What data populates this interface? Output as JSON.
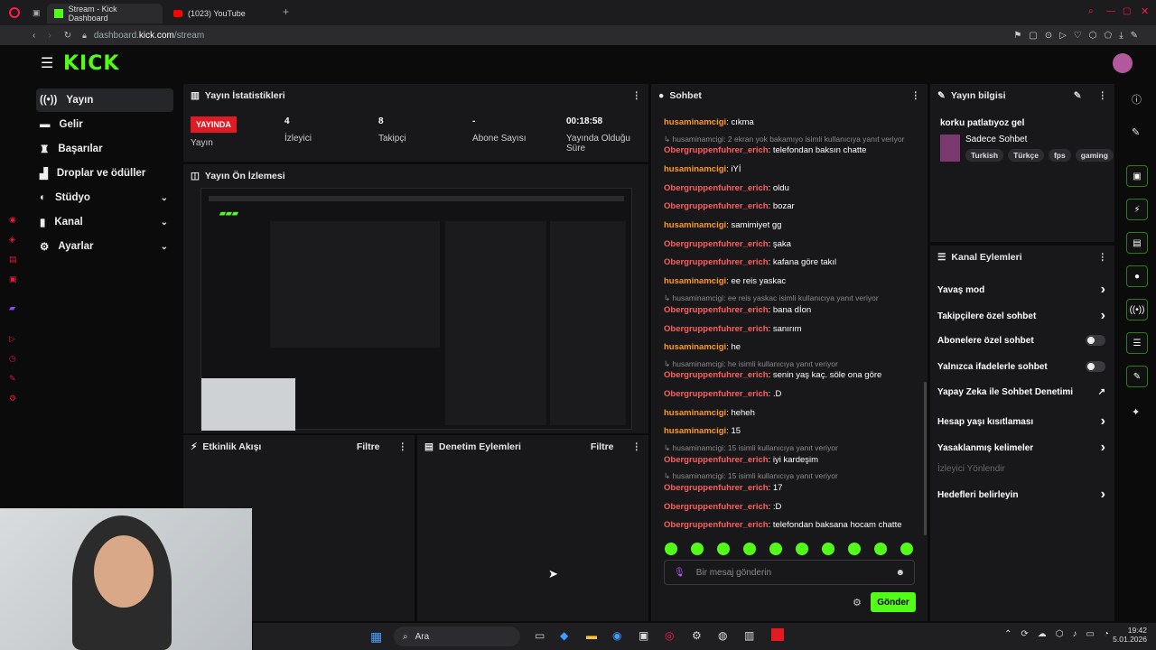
{
  "browser": {
    "tabs": [
      {
        "label": "Stream - Kick Dashboard"
      },
      {
        "label": "(1023) YouTube"
      }
    ],
    "url_prefix": "dashboard.",
    "url_domain": "kick.com",
    "url_path": "/stream"
  },
  "logo": "KICK",
  "sidebar": {
    "items": [
      {
        "label": "Yayın"
      },
      {
        "label": "Gelir"
      },
      {
        "label": "Başarılar"
      },
      {
        "label": "Droplar ve ödüller"
      },
      {
        "label": "Stüdyo"
      },
      {
        "label": "Kanal"
      },
      {
        "label": "Ayarlar"
      }
    ]
  },
  "stats": {
    "title": "Yayın İstatistikleri",
    "live_badge": "YAYINDA",
    "live_label": "Yayın",
    "viewers_value": "4",
    "viewers_label": "İzleyici",
    "followers_value": "8",
    "followers_label": "Takipçi",
    "subs_value": "-",
    "subs_label": "Abone Sayısı",
    "duration_value": "00:18:58",
    "duration_label": "Yayında Olduğu Süre"
  },
  "preview": {
    "title": "Yayın Ön İzlemesi"
  },
  "activity": {
    "title": "Etkinlik Akışı",
    "filter": "Filtre"
  },
  "moderation": {
    "title": "Denetim Eylemleri",
    "filter": "Filtre"
  },
  "chat": {
    "title": "Sohbet",
    "messages": [
      {
        "user": "husaminamcigi",
        "utype": "u1",
        "text": ": cıkma"
      },
      {
        "reply": "husaminamcigi: 2 ekran yok bakamıyo isimli kullanıcıya yanıt veriyor"
      },
      {
        "user": "Obergruppenfuhrer_erich",
        "utype": "u2",
        "text": ": telefondan baksın chatte"
      },
      {
        "user": "husaminamcigi",
        "utype": "u1",
        "text": ": iYİ"
      },
      {
        "user": "Obergruppenfuhrer_erich",
        "utype": "u2",
        "text": ": oldu"
      },
      {
        "user": "Obergruppenfuhrer_erich",
        "utype": "u2",
        "text": ": bozar"
      },
      {
        "user": "husaminamcigi",
        "utype": "u1",
        "text": ": samimiyet gg"
      },
      {
        "user": "Obergruppenfuhrer_erich",
        "utype": "u2",
        "text": ": şaka"
      },
      {
        "user": "Obergruppenfuhrer_erich",
        "utype": "u2",
        "text": ": kafana göre takıl"
      },
      {
        "user": "husaminamcigi",
        "utype": "u1",
        "text": ": ee reis yaskac"
      },
      {
        "reply": "husaminamcigi: ee reis yaskac isimli kullanıcıya yanıt veriyor"
      },
      {
        "user": "Obergruppenfuhrer_erich",
        "utype": "u2",
        "text": ": bana dİon"
      },
      {
        "user": "Obergruppenfuhrer_erich",
        "utype": "u2",
        "text": ": sanırım"
      },
      {
        "user": "husaminamcigi",
        "utype": "u1",
        "text": ": he"
      },
      {
        "reply": "husaminamcigi: he isimli kullanıcıya yanıt veriyor"
      },
      {
        "user": "Obergruppenfuhrer_erich",
        "utype": "u2",
        "text": ": senin yaş kaç. söle ona göre"
      },
      {
        "user": "Obergruppenfuhrer_erich",
        "utype": "u2",
        "text": ": .D"
      },
      {
        "user": "husaminamcigi",
        "utype": "u1",
        "text": ": heheh"
      },
      {
        "user": "husaminamcigi",
        "utype": "u1",
        "text": ": 15"
      },
      {
        "reply": "husaminamcigi: 15 isimli kullanıcıya yanıt veriyor"
      },
      {
        "user": "Obergruppenfuhrer_erich",
        "utype": "u2",
        "text": ": iyi kardeşim"
      },
      {
        "reply": "husaminamcigi: 15 isimli kullanıcıya yanıt veriyor"
      },
      {
        "user": "Obergruppenfuhrer_erich",
        "utype": "u2",
        "text": ": 17"
      },
      {
        "user": "Obergruppenfuhrer_erich",
        "utype": "u2",
        "text": ": :D"
      },
      {
        "user": "Obergruppenfuhrer_erich",
        "utype": "u2",
        "text": ": telefondan baksana hocam chatte"
      }
    ],
    "input_placeholder": "Bir mesaj gönderin",
    "send_label": "Gönder"
  },
  "stream_info": {
    "title": "Yayın bilgisi",
    "stream_title": "korku patlatıyoz gel",
    "category": "Sadece Sohbet",
    "tags": [
      "Turkish",
      "Türkçe",
      "fps",
      "gaming"
    ]
  },
  "channel_actions": {
    "title": "Kanal Eylemleri",
    "items": [
      {
        "label": "Yavaş mod",
        "control": "arrow"
      },
      {
        "label": "Takipçilere özel sohbet",
        "control": "arrow"
      },
      {
        "label": "Abonelere özel sohbet",
        "control": "toggle"
      },
      {
        "label": "Yalnızca ifadelerle sohbet",
        "control": "toggle"
      },
      {
        "label": "Yapay Zeka ile Sohbet Denetimi",
        "control": "external"
      },
      {
        "label": "Hesap yaşı kısıtlaması",
        "control": "arrow"
      },
      {
        "label": "Yasaklanmış kelimeler",
        "control": "arrow"
      },
      {
        "label": "İzleyici Yönlendir",
        "control": "disabled"
      },
      {
        "label": "Hedefleri belirleyin",
        "control": "arrow"
      }
    ]
  },
  "taskbar": {
    "search": "Ara",
    "time": "19:42",
    "date": "5.01.2026"
  },
  "colors": {
    "brand": "#53fc18",
    "live": "#e01b24",
    "user_a": "#ff9a1a",
    "user_b": "#ff5d5d"
  }
}
